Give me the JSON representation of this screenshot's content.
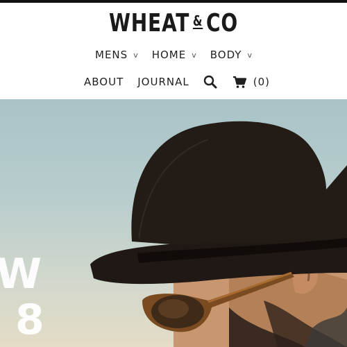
{
  "brand": {
    "name_left": "WHEAT",
    "ampersand": "&",
    "name_right": "CO"
  },
  "nav": {
    "primary": [
      {
        "label": "MENS",
        "caret": "v"
      },
      {
        "label": "HOME",
        "caret": "v"
      },
      {
        "label": "BODY",
        "caret": "v"
      }
    ],
    "secondary": [
      {
        "label": "ABOUT"
      },
      {
        "label": "JOURNAL"
      }
    ],
    "search_icon": "search-icon",
    "cart": {
      "icon": "cart-icon",
      "count": "(0)"
    }
  },
  "hero": {
    "text_line1": "W",
    "text_line2": "8",
    "image": "man-in-black-hat-with-sunglasses"
  },
  "colors": {
    "topbar": "#111111",
    "sky_top": "#a9c3c7",
    "sky_bottom": "#e4dcc6",
    "hat": "#231b16"
  }
}
